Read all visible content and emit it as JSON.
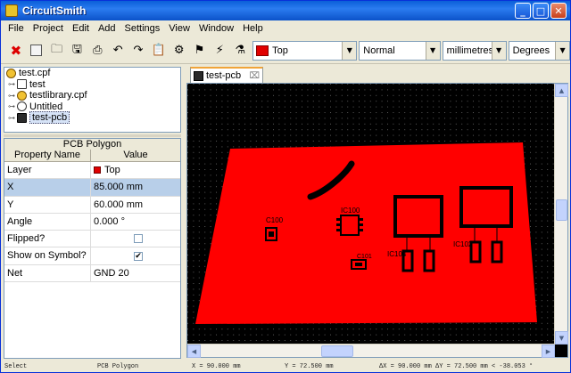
{
  "window": {
    "title": "CircuitSmith",
    "minimize": "_",
    "maximize": "□",
    "close": "✕"
  },
  "menu": [
    "File",
    "Project",
    "Edit",
    "Add",
    "Settings",
    "View",
    "Window",
    "Help"
  ],
  "toolbar": {
    "layer": "Top",
    "mode": "Normal",
    "units": "millimetres",
    "angle_units": "Degrees",
    "layer_color": "#e00000"
  },
  "tree": [
    {
      "label": "test.cpf",
      "icon": "project-icon",
      "indent": 0
    },
    {
      "label": "test",
      "icon": "schematic-icon",
      "indent": 1
    },
    {
      "label": "testlibrary.cpf",
      "icon": "library-icon",
      "indent": 1
    },
    {
      "label": "Untitled",
      "icon": "untitled-icon",
      "indent": 1
    },
    {
      "label": "test-pcb",
      "icon": "pcb-icon",
      "indent": 1,
      "selected": true
    }
  ],
  "properties": {
    "title": "PCB Polygon",
    "col_name": "Property Name",
    "col_value": "Value",
    "rows": [
      {
        "name": "Layer",
        "value": "Top",
        "kind": "color"
      },
      {
        "name": "X",
        "value": "85.000 mm",
        "kind": "text",
        "selected": true
      },
      {
        "name": "Y",
        "value": "60.000 mm",
        "kind": "text"
      },
      {
        "name": "Angle",
        "value": "0.000 °",
        "kind": "text"
      },
      {
        "name": "Flipped?",
        "value": "",
        "kind": "checkbox",
        "checked": false
      },
      {
        "name": "Show on Symbol?",
        "value": "✔",
        "kind": "checkbox",
        "checked": true
      },
      {
        "name": "Net",
        "value": "GND 20",
        "kind": "text"
      }
    ]
  },
  "tab": {
    "label": "test-pcb",
    "close": "⌧"
  },
  "pcb": {
    "polygon_color": "#ff0000",
    "labels": {
      "c100": "C100",
      "ic100": "IC100",
      "c101": "C101",
      "ic104": "IC104",
      "ic102": "IC102"
    }
  },
  "status": {
    "mode": "Select",
    "object": "PCB Polygon",
    "x": "X = 90.000 mm",
    "y": "Y = 72.500 mm",
    "delta": "ΔX = 90.000 mm  ΔY = 72.500 mm < -38.053 °"
  }
}
